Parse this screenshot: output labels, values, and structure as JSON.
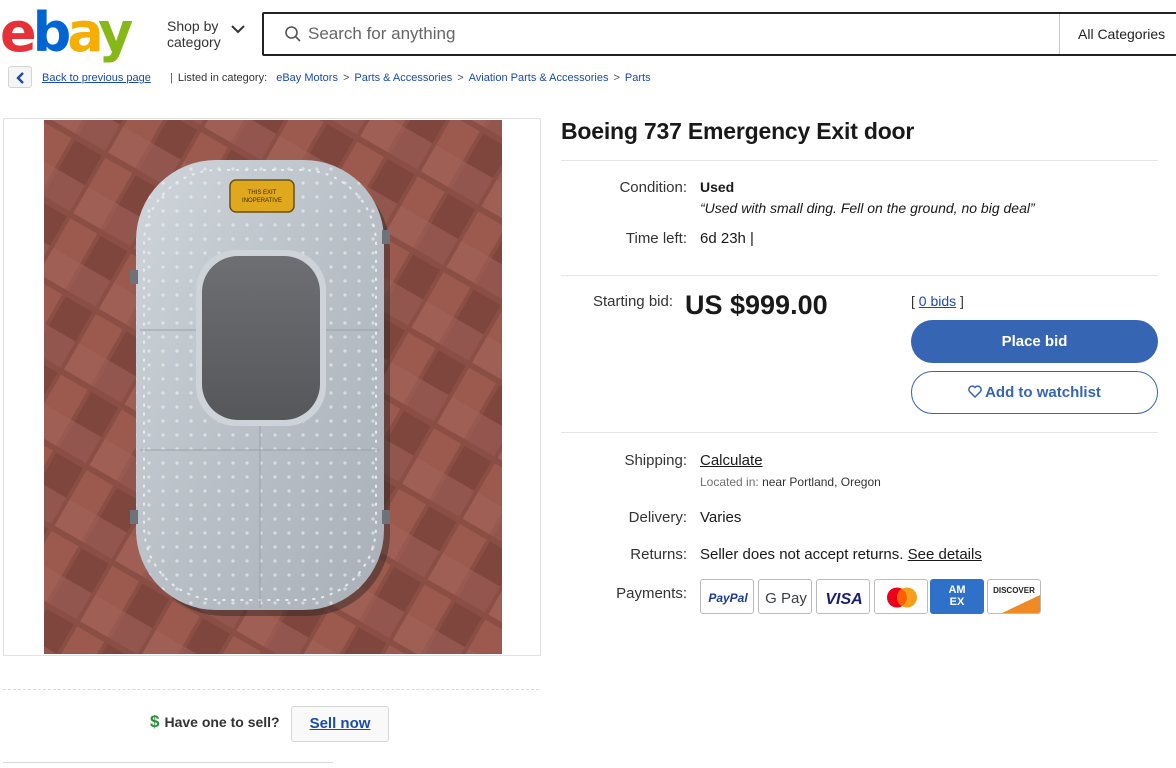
{
  "header": {
    "logo_letters": [
      "e",
      "b",
      "a",
      "y"
    ],
    "shop_by_label": "Shop by category",
    "search_placeholder": "Search for anything",
    "all_categories_label": "All Categories"
  },
  "breadcrumb": {
    "back_label": "Back to previous page",
    "listed_in_label": "Listed in category:",
    "items": [
      "eBay Motors",
      "Parts & Accessories",
      "Aviation Parts & Accessories",
      "Parts"
    ]
  },
  "photo": {
    "placard_text_line1": "THIS EXIT",
    "placard_text_line2": "INOPERATIVE"
  },
  "listing": {
    "title": "Boeing 737 Emergency Exit door",
    "condition_label": "Condition:",
    "condition_value": "Used",
    "condition_note": "“Used with small ding. Fell on the ground, no big deal”",
    "time_left_label": "Time left:",
    "time_left_value": "6d 23h |",
    "starting_bid_label": "Starting bid:",
    "starting_bid_value": "US $999.00",
    "bids_open": "[",
    "bids_link": "0 bids",
    "bids_close": "]",
    "place_bid_label": "Place bid",
    "watchlist_label": "Add to watchlist",
    "shipping_label": "Shipping:",
    "shipping_value": "Calculate",
    "located_label": "Located in:",
    "located_value": "near Portland, Oregon",
    "delivery_label": "Delivery:",
    "delivery_value": "Varies",
    "returns_label": "Returns:",
    "returns_value": "Seller does not accept returns.",
    "returns_link": "See details",
    "payments_label": "Payments:",
    "payment_methods": [
      "PayPal",
      "G Pay",
      "VISA",
      "Mastercard",
      "AM EX",
      "DISCOVER"
    ]
  },
  "sell": {
    "dollar_icon": "$",
    "prompt": "Have one to sell?",
    "button_label": "Sell now"
  },
  "colors": {
    "ebay_red": "#e53238",
    "ebay_blue": "#0064d2",
    "ebay_yellow": "#f5af02",
    "ebay_green": "#86b817",
    "primary_button": "#3665b3",
    "link": "#1a4bab"
  }
}
